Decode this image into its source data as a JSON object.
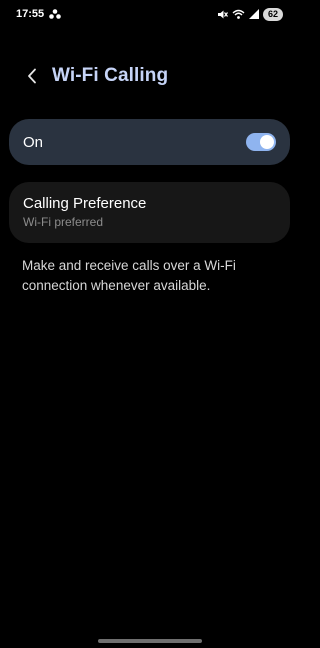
{
  "status_bar": {
    "time": "17:55",
    "notification_icon": "app-notification-icon",
    "mute_icon": "mute-icon",
    "wifi_icon": "wifi-calling-icon",
    "signal_icon": "signal-icon",
    "battery_level": "62"
  },
  "header": {
    "back_icon": "chevron-left-icon",
    "title": "Wi-Fi Calling"
  },
  "main_switch": {
    "label": "On",
    "state": true,
    "accent_color": "#8fb4ef"
  },
  "calling_preference": {
    "title": "Calling Preference",
    "value": "Wi-Fi preferred"
  },
  "description": "Make and receive calls over a Wi-Fi connection whenever available."
}
